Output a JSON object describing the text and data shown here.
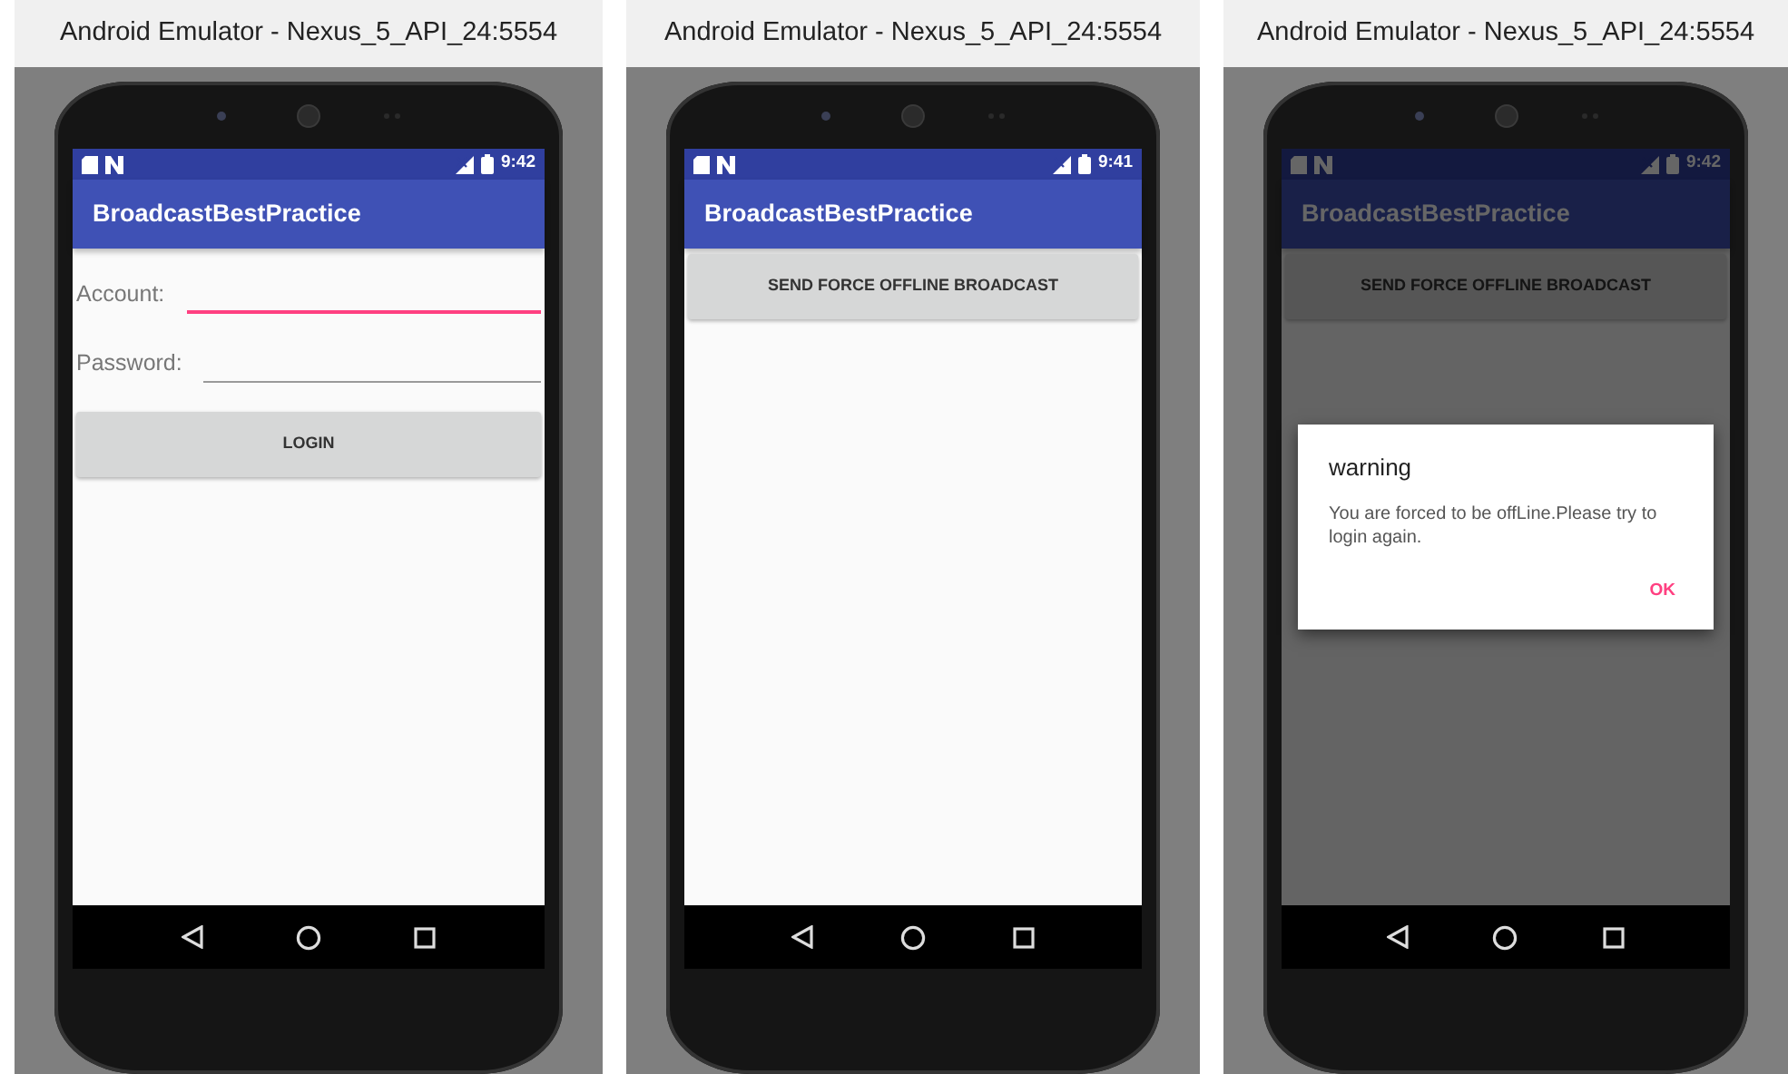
{
  "windows": [
    {
      "title": "Android Emulator - Nexus_5_API_24:5554",
      "status_time": "9:42",
      "app_title": "BroadcastBestPractice",
      "kind": "login",
      "fields": [
        {
          "label": "Account:",
          "focused": true
        },
        {
          "label": "Password:",
          "focused": false
        }
      ],
      "button": "LOGIN"
    },
    {
      "title": "Android Emulator - Nexus_5_API_24:5554",
      "status_time": "9:41",
      "app_title": "BroadcastBestPractice",
      "kind": "sender",
      "button": "SEND FORCE OFFLINE BROADCAST"
    },
    {
      "title": "Android Emulator - Nexus_5_API_24:5554",
      "status_time": "9:42",
      "app_title": "BroadcastBestPractice",
      "kind": "sender",
      "button": "SEND FORCE OFFLINE BROADCAST",
      "dialog": {
        "title": "warning",
        "message": "You are forced to be offLine.Please try to login again.",
        "button": "OK"
      }
    }
  ]
}
